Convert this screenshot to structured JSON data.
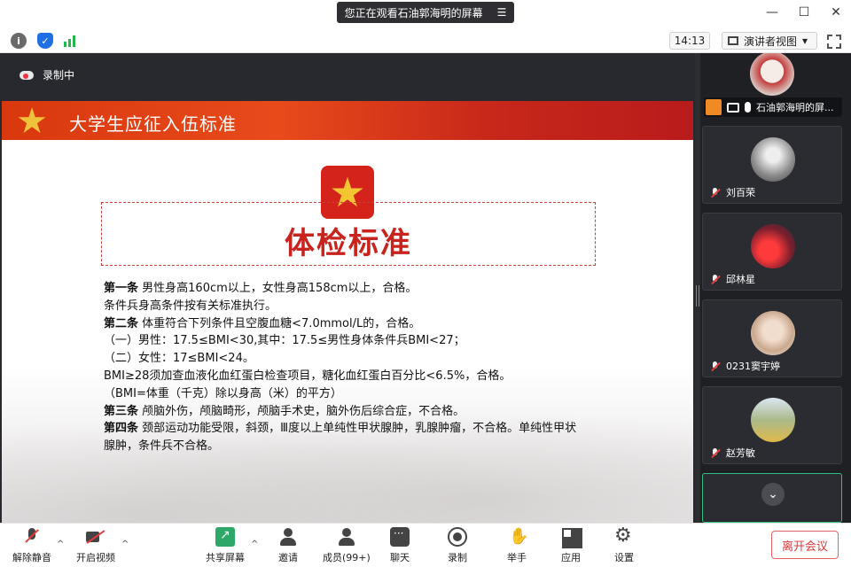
{
  "banner": {
    "text": "您正在观看石油郭海明的屏幕",
    "menu_icon": "menu-lines-icon"
  },
  "window": {
    "minimize": "—",
    "maximize": "☐",
    "close": "✕"
  },
  "subbar": {
    "time": "14:13",
    "view_label": "演讲者视图",
    "view_caret": "▾"
  },
  "share": {
    "recording_label": "录制中",
    "slide_title": "大学生应征入伍标准",
    "std_title": "体检标准",
    "clauses": [
      {
        "bold": "第一条",
        "text": " 男性身高160cm以上，女性身高158cm以上，合格。"
      },
      {
        "bold": "",
        "text": "条件兵身高条件按有关标准执行。"
      },
      {
        "bold": "第二条",
        "text": " 体重符合下列条件且空腹血糖<7.0mmol/L的，合格。"
      },
      {
        "bold": "",
        "text": "（一）男性：17.5≤BMI<30,其中：17.5≤男性身体条件兵BMI<27；"
      },
      {
        "bold": "",
        "text": "（二）女性：17≤BMI<24。"
      },
      {
        "bold": "",
        "text": "BMI≥28须加查血液化血红蛋白检查项目，糖化血红蛋白百分比<6.5%，合格。"
      },
      {
        "bold": "",
        "text": "（BMI=体重（千克）除以身高（米）的平方）"
      },
      {
        "bold": "第三条",
        "text": " 颅脑外伤，颅脑畸形，颅脑手术史，脑外伤后综合症，不合格。"
      },
      {
        "bold": "第四条",
        "text": " 颈部运动功能受限，斜颈，Ⅲ度以上单纯性甲状腺肿，乳腺肿瘤，不合格。单纯性甲状"
      },
      {
        "bold": "",
        "text": "腺肿，条件兵不合格。"
      }
    ]
  },
  "participants": [
    {
      "name": "石油郭海明的屏...",
      "avatar_color": "#d8c7c0"
    },
    {
      "name": "刘百荣",
      "avatar_color": "#b9b9b9"
    },
    {
      "name": "邱林星",
      "avatar_color": "#c0283a"
    },
    {
      "name": "0231窦宇婷",
      "avatar_color": "#d6c2b0"
    },
    {
      "name": "赵芳敏",
      "avatar_color": "#9fb07a"
    }
  ],
  "controls": {
    "unmute": "解除静音",
    "start_video": "开启视频",
    "share_screen": "共享屏幕",
    "invite": "邀请",
    "members": "成员(99+)",
    "chat": "聊天",
    "record": "录制",
    "raise_hand": "举手",
    "apps": "应用",
    "settings": "设置",
    "leave": "离开会议",
    "caret": "^"
  },
  "colors": {
    "accent_red": "#c8231c",
    "leave_red": "#d93a3a",
    "share_green": "#2ea868"
  }
}
